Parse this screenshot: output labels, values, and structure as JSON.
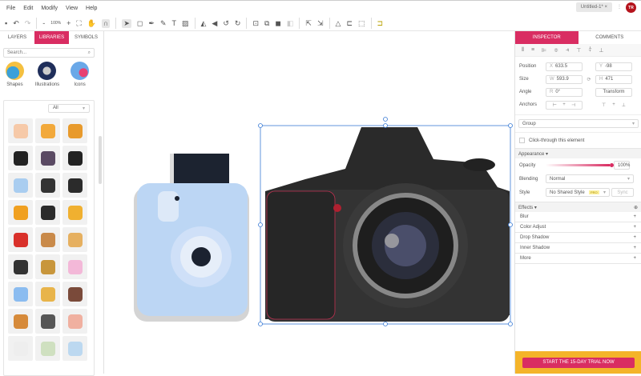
{
  "menu": [
    "File",
    "Edit",
    "Modify",
    "View",
    "Help"
  ],
  "document_tab": "Untitled-1*",
  "avatar_initials": "TR",
  "toolbar": {
    "zoom_label": "100%"
  },
  "left_tabs": [
    "LAYERS",
    "LIBRARIES",
    "SYMBOLS"
  ],
  "search_placeholder": "Search...",
  "categories": [
    "Shapes",
    "Illustrations",
    "Icons"
  ],
  "filter": "All",
  "library_colors": [
    "#f6c9a8",
    "#f2a93b",
    "#e89a2c",
    "#222222",
    "#5a4a63",
    "#222222",
    "#a9cdf0",
    "#333333",
    "#2b2b2b",
    "#f0a020",
    "#2b2b2b",
    "#f0b030",
    "#d9302a",
    "#c98a4a",
    "#e6b060",
    "#333333",
    "#c8963c",
    "#f3b8d8",
    "#8bbcf0",
    "#e8b44a",
    "#7a4a3a",
    "#d68a3a",
    "#555555",
    "#f0b0a0",
    "#eeeeee",
    "#cfe0c0",
    "#bcd8f0"
  ],
  "right_tabs": [
    "INSPECTOR",
    "COMMENTS"
  ],
  "inspector": {
    "position_label": "Position",
    "x_label": "X",
    "x": "633.5",
    "y_label": "Y",
    "y": "-98",
    "size_label": "Size",
    "w_label": "W",
    "w": "593.9",
    "h_label": "H",
    "h": "471",
    "angle_label": "Angle",
    "r_label": "R",
    "angle": "0°",
    "transform": "Transform",
    "anchors_label": "Anchors",
    "type": "Group",
    "click_through": "Click-through this element",
    "appearance": "Appearance",
    "opacity_label": "Opacity",
    "opacity": "100%",
    "opacity_value": 1.0,
    "blending_label": "Blending",
    "blending": "Normal",
    "style_label": "Style",
    "style": "No Shared Style",
    "pro": "PRO",
    "sync": "Sync",
    "effects": "Effects",
    "effect_items": [
      "Blur",
      "Color Adjust",
      "Drop Shadow",
      "Inner Shadow",
      "More"
    ]
  },
  "trial_button": "START THE 15-DAY TRIAL NOW",
  "colors": {
    "accent": "#d92d62",
    "trial_bg": "#f4b42a"
  }
}
